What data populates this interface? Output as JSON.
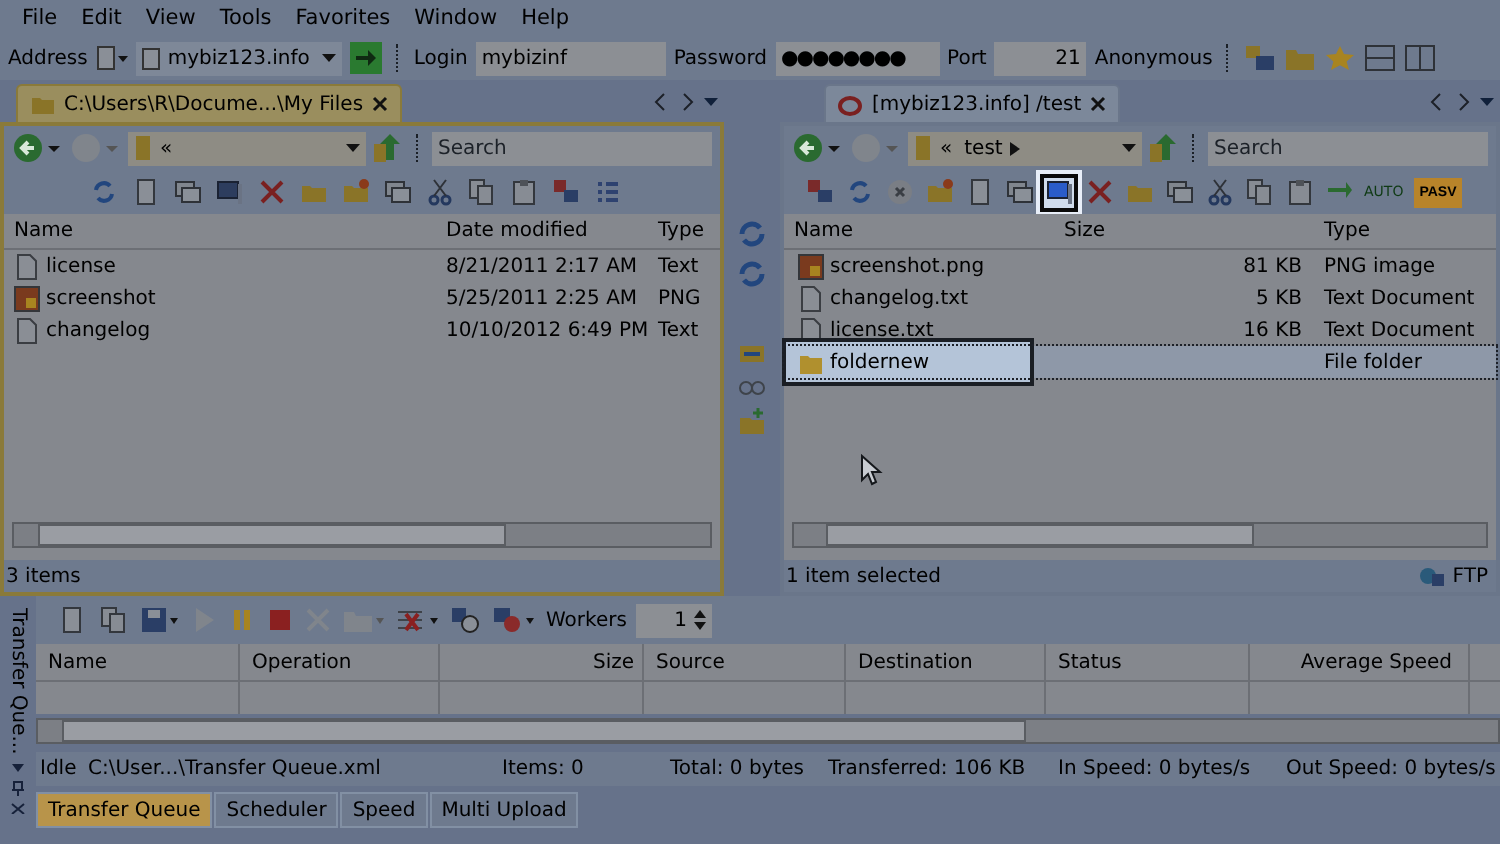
{
  "menu": [
    "File",
    "Edit",
    "View",
    "Tools",
    "Favorites",
    "Window",
    "Help"
  ],
  "address_bar": {
    "address_label": "Address",
    "address": "mybiz123.info",
    "login_label": "Login",
    "login": "mybizinf",
    "password_label": "Password",
    "password": "●●●●●●●●",
    "port_label": "Port",
    "port": "21",
    "anonymous": "Anonymous"
  },
  "local_pane": {
    "tab": "C:\\Users\\R\\Docume...\\My Files",
    "path": "«",
    "search_placeholder": "Search",
    "tools": [
      {
        "kind": "refresh",
        "highlighted": false
      },
      {
        "kind": "page",
        "highlighted": false
      },
      {
        "kind": "window",
        "highlighted": false
      },
      {
        "kind": "monitor",
        "highlighted": false
      },
      {
        "kind": "delete",
        "highlighted": false
      },
      {
        "kind": "folder",
        "highlighted": false
      },
      {
        "kind": "newfolder",
        "highlighted": false
      },
      {
        "kind": "window",
        "highlighted": false
      },
      {
        "kind": "cut",
        "highlighted": false
      },
      {
        "kind": "copy",
        "highlighted": false
      },
      {
        "kind": "paste",
        "highlighted": false
      },
      {
        "kind": "network",
        "highlighted": false
      },
      {
        "kind": "view",
        "highlighted": false
      }
    ],
    "columns": [
      "Name",
      "Date modified",
      "Type"
    ],
    "rows": [
      {
        "kind": "text",
        "name": "license",
        "date": "8/21/2011 2:17 AM",
        "type": "Text"
      },
      {
        "kind": "image",
        "name": "screenshot",
        "date": "5/25/2011 2:25 AM",
        "type": "PNG"
      },
      {
        "kind": "text",
        "name": "changelog",
        "date": "10/10/2012 6:49 PM",
        "type": "Text"
      }
    ],
    "status": "3 items"
  },
  "remote_pane": {
    "tab": "[mybiz123.info] /test",
    "path_prefix": "«",
    "path": "test",
    "search_placeholder": "Search",
    "tools": [
      {
        "kind": "network",
        "highlighted": false
      },
      {
        "kind": "refresh",
        "highlighted": false
      },
      {
        "kind": "stop",
        "highlighted": false
      },
      {
        "kind": "newfolder",
        "highlighted": false
      },
      {
        "kind": "page",
        "highlighted": false
      },
      {
        "kind": "window",
        "highlighted": false
      },
      {
        "kind": "monitor",
        "highlighted": true
      },
      {
        "kind": "delete",
        "highlighted": false
      },
      {
        "kind": "folder",
        "highlighted": false
      },
      {
        "kind": "window",
        "highlighted": false
      },
      {
        "kind": "cut",
        "highlighted": false
      },
      {
        "kind": "copy",
        "highlighted": false
      },
      {
        "kind": "paste",
        "highlighted": false
      },
      {
        "kind": "transfer",
        "highlighted": false
      }
    ],
    "auto_label": "AUTO",
    "pasv": "PASV",
    "columns": [
      "Name",
      "Size",
      "Type"
    ],
    "rows": [
      {
        "kind": "image",
        "name": "screenshot.png",
        "size": "81 KB",
        "type": "PNG image",
        "selected": false
      },
      {
        "kind": "text",
        "name": "changelog.txt",
        "size": "5 KB",
        "type": "Text Document",
        "selected": false
      },
      {
        "kind": "text",
        "name": "license.txt",
        "size": "16 KB",
        "type": "Text Document",
        "selected": false
      },
      {
        "kind": "folder",
        "name": "foldernew",
        "type": "File folder",
        "selected": true
      }
    ],
    "status": "1 item selected",
    "protocol": "FTP"
  },
  "transfer_queue": {
    "side_title": "Transfer Que...",
    "workers_label": "Workers",
    "workers": "1",
    "columns": [
      "Name",
      "Operation",
      "Size",
      "Source",
      "Destination",
      "Status",
      "Average Speed"
    ],
    "status": [
      "Idle",
      "C:\\User...\\Transfer Queue.xml",
      "Items: 0",
      "Total: 0 bytes",
      "Transferred: 106 KB",
      "In Speed: 0 bytes/s",
      "Out Speed: 0 bytes/s"
    ],
    "tabs": [
      {
        "label": "Transfer Queue",
        "selected": true
      },
      {
        "label": "Scheduler",
        "selected": false
      },
      {
        "label": "Speed",
        "selected": false
      },
      {
        "label": "Multi Upload",
        "selected": false
      }
    ]
  }
}
